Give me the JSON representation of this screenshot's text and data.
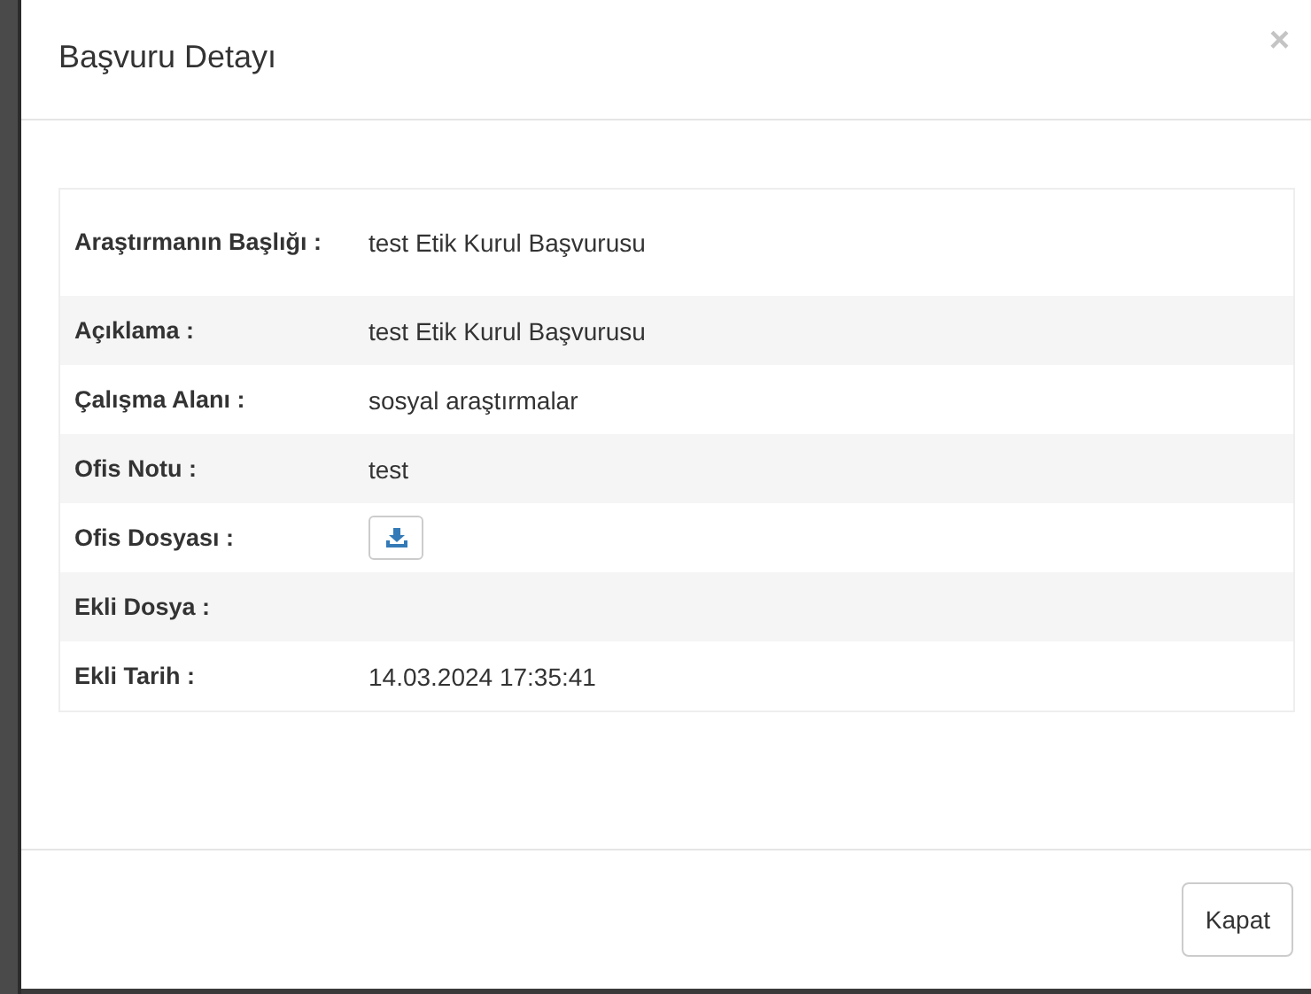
{
  "modal": {
    "title": "Başvuru Detayı",
    "close": "×"
  },
  "details": [
    {
      "kind": "text",
      "label": "Araştırmanın Başlığı :",
      "value": "test Etik Kurul Başvurusu"
    },
    {
      "kind": "text",
      "label": "Açıklama :",
      "value": "test Etik Kurul Başvurusu"
    },
    {
      "kind": "text",
      "label": "Çalışma Alanı :",
      "value": "sosyal araştırmalar"
    },
    {
      "kind": "text",
      "label": "Ofis Notu :",
      "value": "test"
    },
    {
      "kind": "download",
      "label": "Ofis Dosyası :"
    },
    {
      "kind": "empty",
      "label": "Ekli Dosya :"
    },
    {
      "kind": "text",
      "label": "Ekli Tarih :",
      "value": "14.03.2024 17:35:41"
    }
  ],
  "footer": {
    "button": "Kapat"
  }
}
